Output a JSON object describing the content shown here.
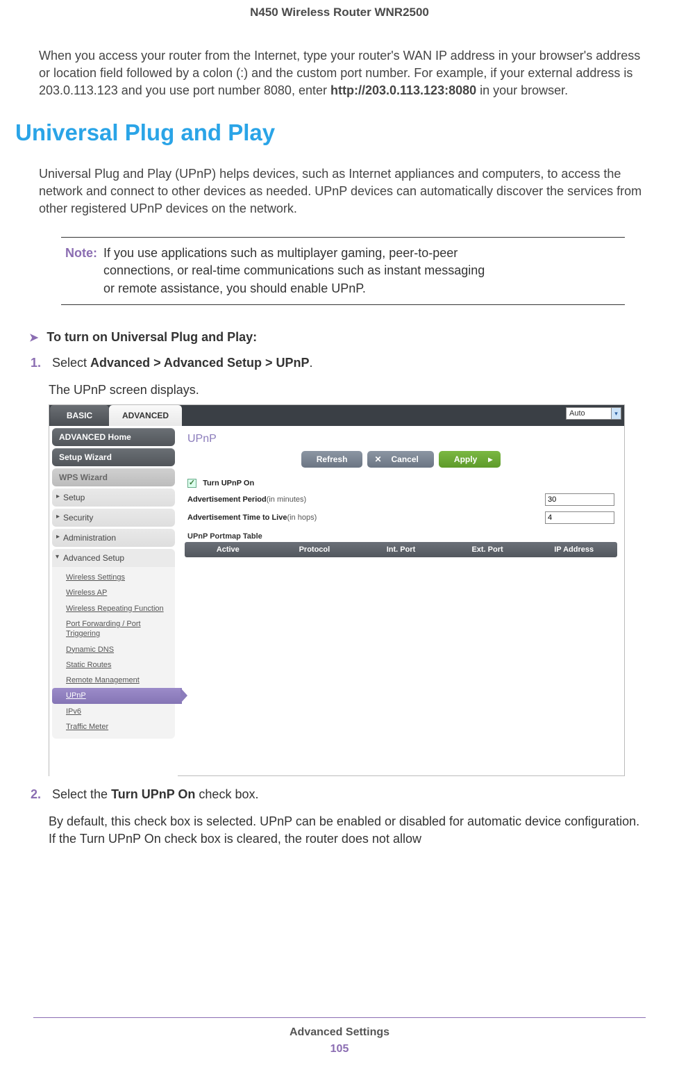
{
  "header": {
    "title": "N450 Wireless Router WNR2500"
  },
  "intro": {
    "text_a": "When you access your router from the Internet, type your router's WAN IP address in your browser's address or location field followed by a colon (:) and the custom port number. For example, if your external address is 203.0.113.123 and you use port number 8080, enter ",
    "text_bold": "http://203.0.113.123:8080",
    "text_b": " in your browser."
  },
  "section": {
    "heading": "Universal Plug and Play",
    "para": "Universal Plug and Play (UPnP) helps devices, such as Internet appliances and computers, to access the network and connect to other devices as needed. UPnP devices can automatically discover the services from other registered UPnP devices on the network."
  },
  "note": {
    "label": "Note:",
    "text": "If you use applications such as multiplayer gaming, peer-to-peer connections, or real-time communications such as instant messaging or remote assistance, you should enable UPnP."
  },
  "procedure": {
    "title": "To turn on Universal Plug and Play:",
    "steps": [
      {
        "num": "1.",
        "pre": "Select ",
        "bold": "Advanced > Advanced Setup > UPnP",
        "post": ".",
        "sub": "The UPnP screen displays."
      },
      {
        "num": "2.",
        "pre": "Select the ",
        "bold": "Turn UPnP On",
        "post": " check box.",
        "sub": "By default, this check box is selected. UPnP can be enabled or disabled for automatic device configuration. If the Turn UPnP On check box is cleared, the router does not allow"
      }
    ]
  },
  "screenshot": {
    "tabs": {
      "basic": "BASIC",
      "advanced": "ADVANCED"
    },
    "auto_dropdown": "Auto",
    "sidebar": {
      "adv_home": "ADVANCED Home",
      "setup_wizard": "Setup Wizard",
      "wps_wizard": "WPS Wizard",
      "setup": "Setup",
      "security": "Security",
      "administration": "Administration",
      "advanced_setup": "Advanced Setup",
      "sub": [
        "Wireless Settings",
        "Wireless AP",
        "Wireless Repeating Function",
        "Port Forwarding / Port Triggering",
        "Dynamic DNS",
        "Static Routes",
        "Remote Management",
        "UPnP",
        "IPv6",
        "Traffic Meter"
      ]
    },
    "page_title": "UPnP",
    "buttons": {
      "refresh": "Refresh",
      "cancel": "Cancel",
      "apply": "Apply"
    },
    "form": {
      "turn_on_label": "Turn UPnP On",
      "turn_on_checked": true,
      "adv_period_label": "Advertisement Period",
      "adv_period_unit": "(in minutes)",
      "adv_period_value": "30",
      "adv_ttl_label": "Advertisement Time to Live",
      "adv_ttl_unit": "(in hops)",
      "adv_ttl_value": "4"
    },
    "table": {
      "title": "UPnP Portmap Table",
      "cols": [
        "Active",
        "Protocol",
        "Int. Port",
        "Ext. Port",
        "IP Address"
      ]
    }
  },
  "footer": {
    "section": "Advanced Settings",
    "page": "105"
  }
}
